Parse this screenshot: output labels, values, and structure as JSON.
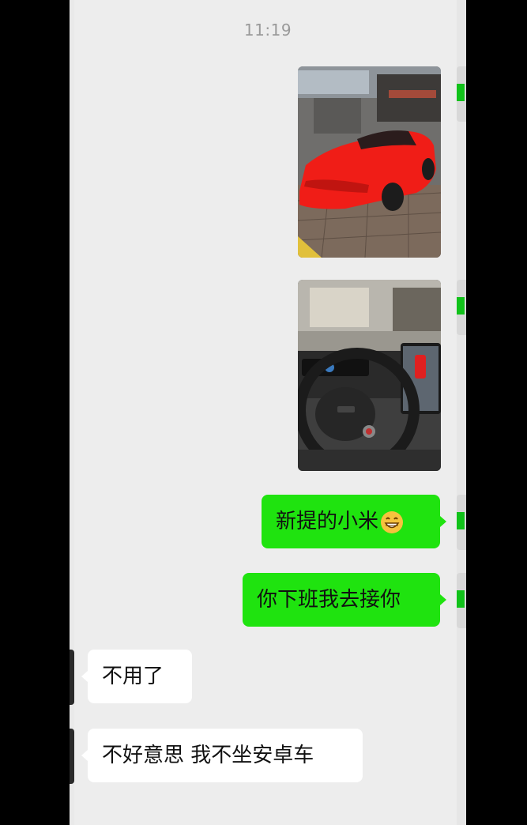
{
  "chat": {
    "timestamp": "11:19",
    "messages": [
      {
        "side": "out",
        "type": "image",
        "image_desc": "red-car-photo"
      },
      {
        "side": "out",
        "type": "image",
        "image_desc": "car-interior-photo"
      },
      {
        "side": "out",
        "type": "text",
        "text": "新提的小米",
        "emoji": "grinning-face-icon"
      },
      {
        "side": "out",
        "type": "text",
        "text": "你下班我去接你"
      },
      {
        "side": "in",
        "type": "text",
        "text": "不用了"
      },
      {
        "side": "in",
        "type": "text",
        "text": "不好意思 我不坐安卓车"
      }
    ]
  },
  "colors": {
    "outgoing_bubble": "#1fe30f",
    "incoming_bubble": "#ffffff",
    "chat_background": "#ededed"
  }
}
